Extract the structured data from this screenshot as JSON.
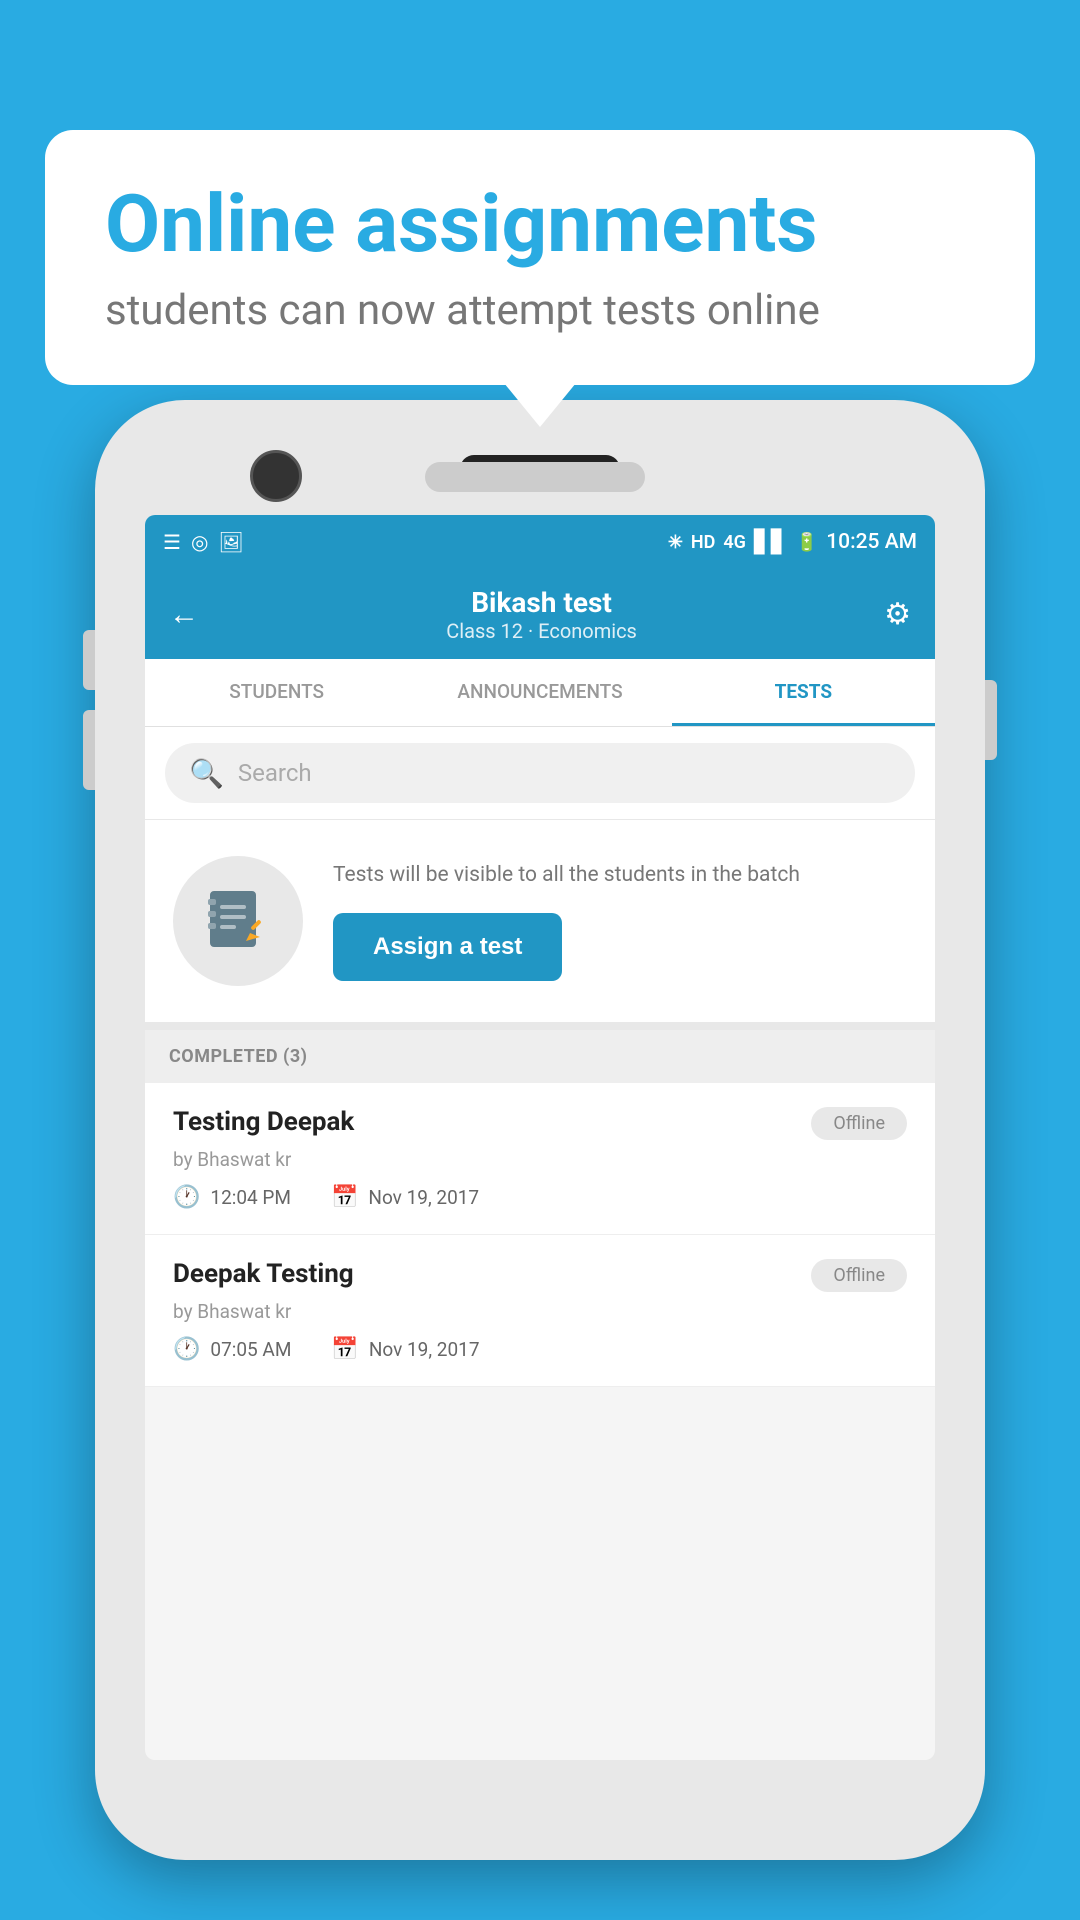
{
  "background": {
    "color": "#29abe2"
  },
  "speech_bubble": {
    "title": "Online assignments",
    "subtitle": "students can now attempt tests online"
  },
  "status_bar": {
    "time": "10:25 AM",
    "signal_text": "HD 4G",
    "icons": [
      "☰",
      "◎",
      "🖼"
    ]
  },
  "app_bar": {
    "title": "Bikash test",
    "subtitle": "Class 12 · Economics",
    "back_icon": "←",
    "settings_icon": "⚙"
  },
  "tabs": [
    {
      "label": "STUDENTS",
      "active": false
    },
    {
      "label": "ANNOUNCEMENTS",
      "active": false
    },
    {
      "label": "TESTS",
      "active": true
    }
  ],
  "search": {
    "placeholder": "Search"
  },
  "assign_section": {
    "description": "Tests will be visible to all the students in the batch",
    "button_label": "Assign a test"
  },
  "completed_section": {
    "header": "COMPLETED (3)"
  },
  "test_items": [
    {
      "name": "Testing Deepak",
      "author": "by Bhaswat kr",
      "time": "12:04 PM",
      "date": "Nov 19, 2017",
      "badge": "Offline"
    },
    {
      "name": "Deepak Testing",
      "author": "by Bhaswat kr",
      "time": "07:05 AM",
      "date": "Nov 19, 2017",
      "badge": "Offline"
    }
  ]
}
